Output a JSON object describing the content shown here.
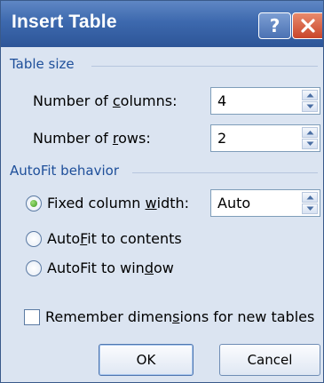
{
  "window": {
    "title": "Insert Table",
    "help_button": "?",
    "close_button": "X"
  },
  "table_size": {
    "group_label": "Table size",
    "columns_label_pre": "Number of ",
    "columns_label_ul": "c",
    "columns_label_post": "olumns:",
    "columns_value": "4",
    "rows_label_pre": "Number of ",
    "rows_label_ul": "r",
    "rows_label_post": "ows:",
    "rows_value": "2"
  },
  "autofit": {
    "group_label": "AutoFit behavior",
    "fixed_pre": "Fixed column ",
    "fixed_ul": "w",
    "fixed_post": "idth:",
    "fixed_value": "Auto",
    "fixed_selected": true,
    "contents_pre": "Auto",
    "contents_ul": "F",
    "contents_post": "it to contents",
    "window_pre": "AutoFit to win",
    "window_ul": "d",
    "window_post": "ow"
  },
  "remember": {
    "label_pre": "Remember dimen",
    "label_ul": "s",
    "label_post": "ions for new tables",
    "checked": false
  },
  "buttons": {
    "ok": "OK",
    "cancel": "Cancel"
  },
  "colors": {
    "title_bar": "#3d69ae",
    "group_label": "#1e4f9a",
    "dialog_bg": "#dbe4f1"
  }
}
